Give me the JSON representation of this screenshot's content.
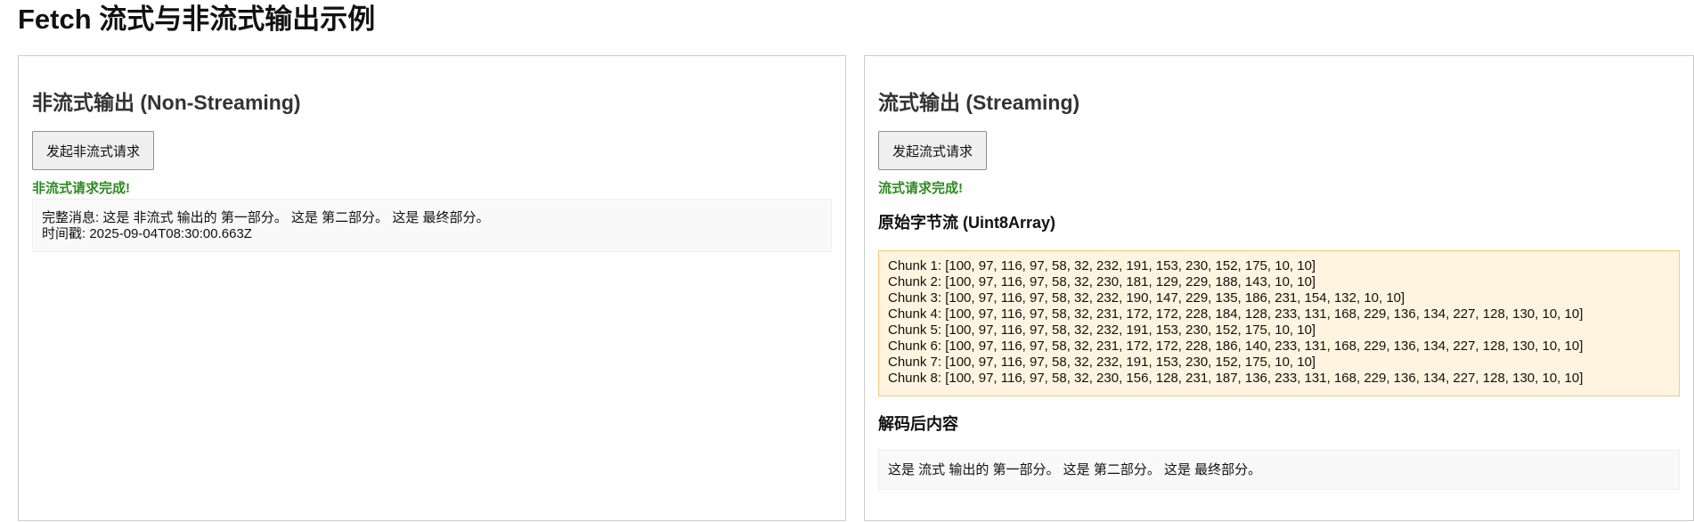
{
  "page": {
    "title": "Fetch 流式与非流式输出示例"
  },
  "non_streaming": {
    "title": "非流式输出 (Non-Streaming)",
    "button_label": "发起非流式请求",
    "status": "非流式请求完成!",
    "result_lines": [
      "完整消息: 这是 非流式 输出的 第一部分。 这是 第二部分。 这是 最终部分。",
      "时间戳: 2025-09-04T08:30:00.663Z"
    ]
  },
  "streaming": {
    "title": "流式输出 (Streaming)",
    "button_label": "发起流式请求",
    "status": "流式请求完成!",
    "bytes_heading": "原始字节流 (Uint8Array)",
    "chunks": [
      "Chunk 1: [100, 97, 116, 97, 58, 32, 232, 191, 153, 230, 152, 175, 10, 10]",
      "Chunk 2: [100, 97, 116, 97, 58, 32, 230, 181, 129, 229, 188, 143, 10, 10]",
      "Chunk 3: [100, 97, 116, 97, 58, 32, 232, 190, 147, 229, 135, 186, 231, 154, 132, 10, 10]",
      "Chunk 4: [100, 97, 116, 97, 58, 32, 231, 172, 172, 228, 184, 128, 233, 131, 168, 229, 136, 134, 227, 128, 130, 10, 10]",
      "Chunk 5: [100, 97, 116, 97, 58, 32, 232, 191, 153, 230, 152, 175, 10, 10]",
      "Chunk 6: [100, 97, 116, 97, 58, 32, 231, 172, 172, 228, 186, 140, 233, 131, 168, 229, 136, 134, 227, 128, 130, 10, 10]",
      "Chunk 7: [100, 97, 116, 97, 58, 32, 232, 191, 153, 230, 152, 175, 10, 10]",
      "Chunk 8: [100, 97, 116, 97, 58, 32, 230, 156, 128, 231, 187, 136, 233, 131, 168, 229, 136, 134, 227, 128, 130, 10, 10]"
    ],
    "decoded_heading": "解码后内容",
    "decoded_text": "这是 流式 输出的 第一部分。 这是 第二部分。 这是 最终部分。"
  },
  "colors": {
    "status_success": "#2e8b22",
    "bytes_box_background": "#fff4e0",
    "bytes_box_border": "#f4c77d"
  }
}
